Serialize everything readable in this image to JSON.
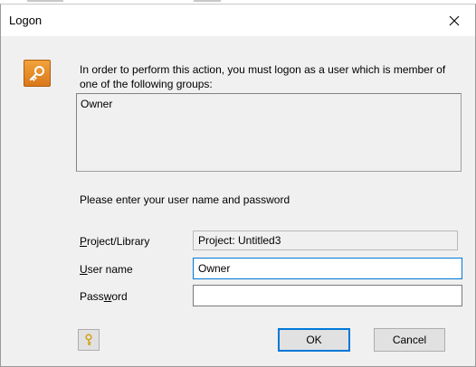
{
  "dialog": {
    "title": "Logon",
    "message": "In order to perform this action, you must logon as a user which is member of one of the following groups:",
    "groups": [
      "Owner"
    ],
    "prompt": "Please enter your user name and password"
  },
  "fields": {
    "project": {
      "label_pre": "",
      "label_u": "P",
      "label_post": "roject/Library",
      "value": "Project: Untitled3"
    },
    "username": {
      "label_pre": "",
      "label_u": "U",
      "label_post": "ser name",
      "value": "Owner"
    },
    "password": {
      "label_pre": "Pass",
      "label_u": "w",
      "label_post": "ord",
      "value": ""
    }
  },
  "buttons": {
    "ok": "OK",
    "cancel": "Cancel"
  },
  "icons": {
    "dialog_icon": "key-icon",
    "hint_icon": "key-small-icon",
    "close_icon": "close-icon"
  },
  "colors": {
    "accent": "#0078d7",
    "icon_orange": "#e8891f"
  }
}
